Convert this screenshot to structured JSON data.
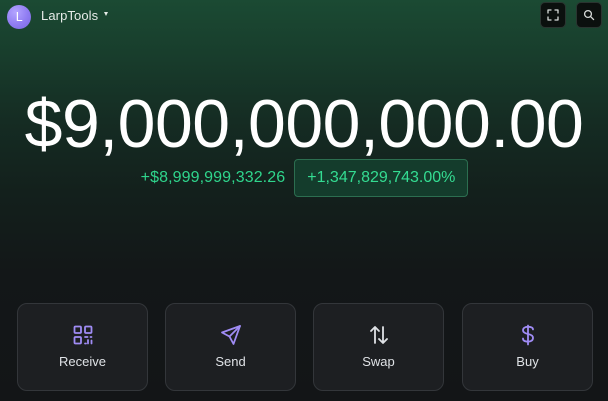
{
  "header": {
    "avatar_letter": "L",
    "account_name": "LarpTools"
  },
  "portfolio": {
    "balance": "$9,000,000,000.00",
    "change_amount": "+$8,999,999,332.26",
    "change_percent": "+1,347,829,743.00%"
  },
  "actions": [
    {
      "label": "Receive",
      "icon": "qr-code-icon"
    },
    {
      "label": "Send",
      "icon": "send-icon"
    },
    {
      "label": "Swap",
      "icon": "swap-icon"
    },
    {
      "label": "Buy",
      "icon": "dollar-icon"
    }
  ],
  "colors": {
    "accent_purple": "#a08cf5",
    "positive_green": "#2fd58c",
    "background_top": "#1b4a33",
    "background_bottom": "#131517"
  }
}
